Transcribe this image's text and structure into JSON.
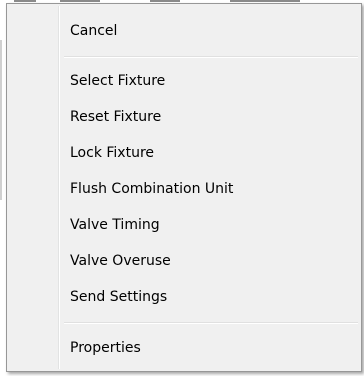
{
  "context_menu": {
    "items": [
      {
        "label": "Cancel"
      },
      {
        "label": "Select Fixture"
      },
      {
        "label": "Reset Fixture"
      },
      {
        "label": "Lock Fixture"
      },
      {
        "label": "Flush Combination Unit"
      },
      {
        "label": "Valve Timing"
      },
      {
        "label": "Valve Overuse"
      },
      {
        "label": "Send Settings"
      },
      {
        "label": "Properties"
      }
    ]
  },
  "colors": {
    "menu_background": "#f0f0f0",
    "menu_border": "#979797",
    "text": "#000000",
    "separator": "#e0e0e0"
  }
}
